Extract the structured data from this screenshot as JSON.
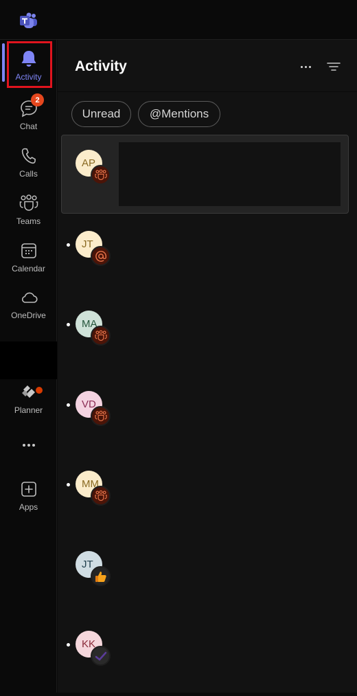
{
  "app": {
    "name": "Microsoft Teams",
    "logo_icon": "teams-logo-icon"
  },
  "rail": {
    "items": [
      {
        "id": "activity",
        "label": "Activity",
        "icon": "bell-icon",
        "active": true
      },
      {
        "id": "chat",
        "label": "Chat",
        "icon": "chat-icon",
        "badge": "2"
      },
      {
        "id": "calls",
        "label": "Calls",
        "icon": "phone-icon"
      },
      {
        "id": "teams",
        "label": "Teams",
        "icon": "teams-people-icon"
      },
      {
        "id": "calendar",
        "label": "Calendar",
        "icon": "calendar-icon"
      },
      {
        "id": "onedrive",
        "label": "OneDrive",
        "icon": "cloud-icon"
      },
      {
        "id": "planner",
        "label": "Planner",
        "icon": "planner-icon"
      },
      {
        "id": "more",
        "label": "",
        "icon": "more-horizontal-icon",
        "has_notification_dot": true
      },
      {
        "id": "apps",
        "label": "Apps",
        "icon": "add-app-icon"
      }
    ],
    "colors": {
      "accent": "#7f85f5",
      "badge": "#e5471e",
      "highlight_box": "#e0141e"
    }
  },
  "activity": {
    "title": "Activity",
    "more_options_icon": "more-horizontal-icon",
    "filter_icon": "filter-icon",
    "filters": [
      {
        "label": "Unread"
      },
      {
        "label": "@Mentions"
      }
    ],
    "feed": [
      {
        "initials": "AP",
        "avatar_bg": "#fbeccb",
        "avatar_fg": "#8a6a22",
        "type": "team",
        "unread": false,
        "selected": true
      },
      {
        "initials": "JT",
        "avatar_bg": "#fbeccb",
        "avatar_fg": "#8a6a22",
        "type": "mention",
        "unread": true
      },
      {
        "initials": "MA",
        "avatar_bg": "#cfe2d8",
        "avatar_fg": "#26563c",
        "type": "team",
        "unread": true
      },
      {
        "initials": "VD",
        "avatar_bg": "#f4d3e1",
        "avatar_fg": "#8a2c54",
        "type": "team",
        "unread": true
      },
      {
        "initials": "MM",
        "avatar_bg": "#fbeccb",
        "avatar_fg": "#8a6a22",
        "type": "team",
        "unread": true
      },
      {
        "initials": "JT",
        "avatar_bg": "#d0dde3",
        "avatar_fg": "#23414f",
        "type": "reaction-like",
        "unread": false
      },
      {
        "initials": "KK",
        "avatar_bg": "#f5d7dc",
        "avatar_fg": "#8a2c3a",
        "type": "task-complete",
        "unread": true
      }
    ]
  }
}
